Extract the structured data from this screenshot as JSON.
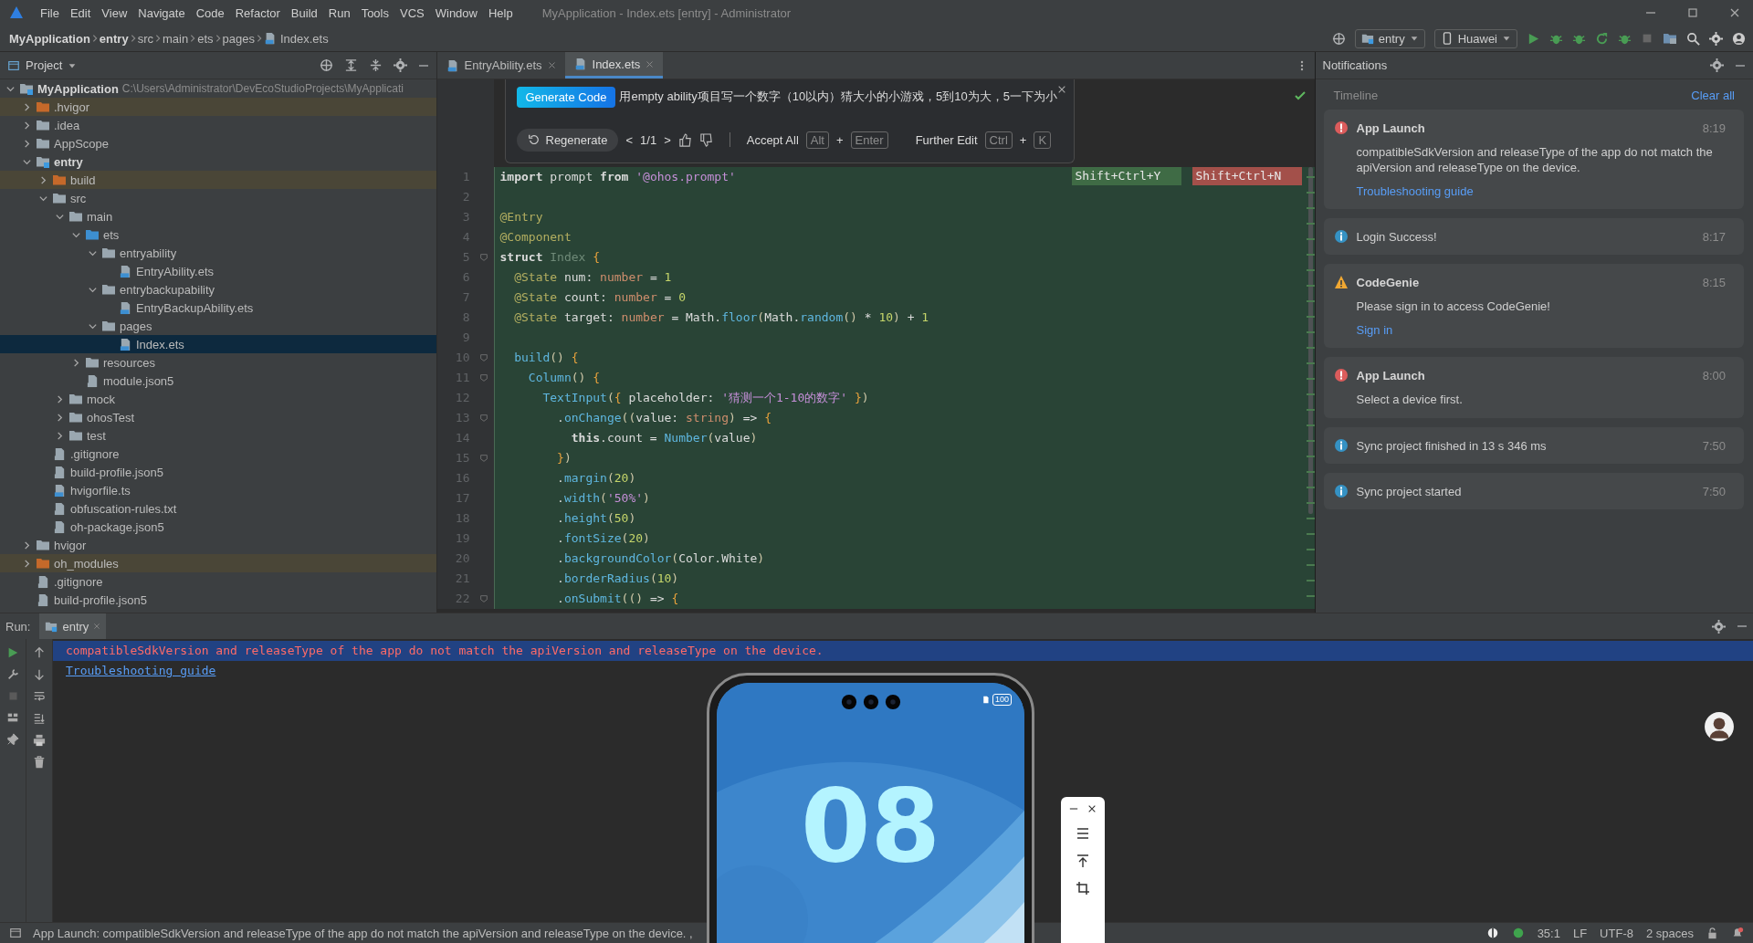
{
  "menu_bar": {
    "items": [
      "File",
      "Edit",
      "View",
      "Navigate",
      "Code",
      "Refactor",
      "Build",
      "Run",
      "Tools",
      "VCS",
      "Window",
      "Help"
    ],
    "window_title": "MyApplication - Index.ets [entry] - Administrator"
  },
  "breadcrumb": [
    {
      "label": "MyApplication",
      "kind": "module"
    },
    {
      "label": "entry",
      "kind": "module"
    },
    {
      "label": "src",
      "kind": "folder"
    },
    {
      "label": "main",
      "kind": "folder"
    },
    {
      "label": "ets",
      "kind": "folder"
    },
    {
      "label": "pages",
      "kind": "folder"
    },
    {
      "label": "Index.ets",
      "kind": "file"
    }
  ],
  "toolbar": {
    "run_config": "entry",
    "device": "Huawei"
  },
  "project": {
    "title": "Project",
    "tree": [
      {
        "label": "MyApplication",
        "kind": "module",
        "path": "C:\\Users\\Administrator\\DevEcoStudioProjects\\MyApplicati",
        "expanded": true,
        "selected": false,
        "children": [
          {
            "label": ".hvigor",
            "kind": "excluded",
            "expanded": false,
            "selected": false
          },
          {
            "label": ".idea",
            "kind": "folder",
            "expanded": false,
            "selected": false
          },
          {
            "label": "AppScope",
            "kind": "folder",
            "expanded": false,
            "selected": false
          },
          {
            "label": "entry",
            "kind": "module",
            "expanded": true,
            "selected": false,
            "children": [
              {
                "label": "build",
                "kind": "excluded",
                "expanded": false,
                "selected": false
              },
              {
                "label": "src",
                "kind": "folder",
                "expanded": true,
                "selected": false,
                "children": [
                  {
                    "label": "main",
                    "kind": "folder",
                    "expanded": true,
                    "selected": false,
                    "children": [
                      {
                        "label": "ets",
                        "kind": "source",
                        "expanded": true,
                        "selected": false,
                        "children": [
                          {
                            "label": "entryability",
                            "kind": "folder",
                            "expanded": true,
                            "selected": false,
                            "children": [
                              {
                                "label": "EntryAbility.ets",
                                "kind": "ets",
                                "selected": false
                              }
                            ]
                          },
                          {
                            "label": "entrybackupability",
                            "kind": "folder",
                            "expanded": true,
                            "selected": false,
                            "children": [
                              {
                                "label": "EntryBackupAbility.ets",
                                "kind": "ets",
                                "selected": false
                              }
                            ]
                          },
                          {
                            "label": "pages",
                            "kind": "folder",
                            "expanded": true,
                            "selected": false,
                            "children": [
                              {
                                "label": "Index.ets",
                                "kind": "ets",
                                "selected": true
                              }
                            ]
                          }
                        ]
                      },
                      {
                        "label": "resources",
                        "kind": "folder",
                        "expanded": false,
                        "selected": false
                      },
                      {
                        "label": "module.json5",
                        "kind": "json",
                        "selected": false
                      }
                    ]
                  },
                  {
                    "label": "mock",
                    "kind": "folder",
                    "expanded": false,
                    "selected": false
                  },
                  {
                    "label": "ohosTest",
                    "kind": "folder",
                    "expanded": false,
                    "selected": false
                  },
                  {
                    "label": "test",
                    "kind": "folder",
                    "expanded": false,
                    "selected": false
                  }
                ]
              },
              {
                "label": ".gitignore",
                "kind": "ignore",
                "selected": false
              },
              {
                "label": "build-profile.json5",
                "kind": "json",
                "selected": false
              },
              {
                "label": "hvigorfile.ts",
                "kind": "ts",
                "selected": false
              },
              {
                "label": "obfuscation-rules.txt",
                "kind": "txt",
                "selected": false
              },
              {
                "label": "oh-package.json5",
                "kind": "json",
                "selected": false
              }
            ]
          },
          {
            "label": "hvigor",
            "kind": "folder",
            "expanded": false,
            "selected": false
          },
          {
            "label": "oh_modules",
            "kind": "excluded",
            "expanded": false,
            "selected": false
          },
          {
            "label": ".gitignore",
            "kind": "ignore",
            "selected": false
          },
          {
            "label": "build-profile.json5",
            "kind": "json",
            "selected": false
          }
        ]
      }
    ]
  },
  "editor": {
    "tabs": [
      {
        "label": "EntryAbility.ets",
        "selected": false
      },
      {
        "label": "Index.ets",
        "selected": true
      }
    ],
    "assistant": {
      "button": "Generate Code",
      "prompt": "用empty ability项目写一个数字（10以内）猜大小的小游戏，5到10为大，5一下为小",
      "regenerate": "Regenerate",
      "prev": "<",
      "page": "1/1",
      "next": ">",
      "accept": "Accept All",
      "accept_keys": [
        {
          "kind": "key",
          "text": "Alt"
        },
        {
          "kind": "plus",
          "text": "+"
        },
        {
          "kind": "key",
          "text": "Enter"
        }
      ],
      "edit": "Further Edit",
      "edit_keys": [
        {
          "kind": "key",
          "text": "Ctrl"
        },
        {
          "kind": "plus",
          "text": "+"
        },
        {
          "kind": "key",
          "text": "K"
        }
      ]
    },
    "diff_shortcuts": [
      {
        "label": "Shift+Ctrl+Y",
        "kind": "accept"
      },
      {
        "label": "Shift+Ctrl+N",
        "kind": "reject"
      }
    ],
    "lines": [
      {
        "n": "1",
        "fold": false,
        "tokens": [
          {
            "kind": "kw",
            "text": "import "
          },
          {
            "kind": "plain",
            "text": "prompt "
          },
          {
            "kind": "kw",
            "text": "from "
          },
          {
            "kind": "str",
            "text": "'@ohos.prompt'"
          }
        ]
      },
      {
        "n": "2",
        "fold": false
      },
      {
        "n": "3",
        "fold": false,
        "tokens": [
          {
            "kind": "dec",
            "text": "@Entry"
          }
        ]
      },
      {
        "n": "4",
        "fold": false,
        "tokens": [
          {
            "kind": "dec",
            "text": "@Component"
          }
        ]
      },
      {
        "n": "5",
        "fold": true,
        "tokens": [
          {
            "kind": "kw",
            "text": "struct "
          },
          {
            "kind": "cls",
            "text": "Index "
          },
          {
            "kind": "brace",
            "text": "{"
          }
        ]
      },
      {
        "n": "6",
        "fold": false,
        "tokens": [
          {
            "kind": "dec",
            "text": "  @State "
          },
          {
            "kind": "plain",
            "text": "num: "
          },
          {
            "kind": "type",
            "text": "number "
          },
          {
            "kind": "plain",
            "text": "= "
          },
          {
            "kind": "num",
            "text": "1"
          }
        ]
      },
      {
        "n": "7",
        "fold": false,
        "tokens": [
          {
            "kind": "dec",
            "text": "  @State "
          },
          {
            "kind": "plain",
            "text": "count: "
          },
          {
            "kind": "type",
            "text": "number "
          },
          {
            "kind": "plain",
            "text": "= "
          },
          {
            "kind": "num",
            "text": "0"
          }
        ]
      },
      {
        "n": "8",
        "fold": false,
        "tokens": [
          {
            "kind": "dec",
            "text": "  @State "
          },
          {
            "kind": "plain",
            "text": "target: "
          },
          {
            "kind": "type",
            "text": "number "
          },
          {
            "kind": "plain",
            "text": "= Math."
          },
          {
            "kind": "fn",
            "text": "floor"
          },
          {
            "kind": "paren",
            "text": "("
          },
          {
            "kind": "plain",
            "text": "Math."
          },
          {
            "kind": "fn",
            "text": "random"
          },
          {
            "kind": "paren",
            "text": "() "
          },
          {
            "kind": "plain",
            "text": "* "
          },
          {
            "kind": "num",
            "text": "10"
          },
          {
            "kind": "paren",
            "text": ") "
          },
          {
            "kind": "plain",
            "text": "+ "
          },
          {
            "kind": "num",
            "text": "1"
          }
        ]
      },
      {
        "n": "9",
        "fold": false
      },
      {
        "n": "10",
        "fold": true,
        "tokens": [
          {
            "kind": "fn",
            "text": "  build"
          },
          {
            "kind": "paren",
            "text": "() "
          },
          {
            "kind": "brace",
            "text": "{"
          }
        ]
      },
      {
        "n": "11",
        "fold": true,
        "tokens": [
          {
            "kind": "fn",
            "text": "    Column"
          },
          {
            "kind": "paren",
            "text": "() "
          },
          {
            "kind": "brace",
            "text": "{"
          }
        ]
      },
      {
        "n": "12",
        "fold": false,
        "tokens": [
          {
            "kind": "fn",
            "text": "      TextInput"
          },
          {
            "kind": "paren",
            "text": "("
          },
          {
            "kind": "brace",
            "text": "{ "
          },
          {
            "kind": "plain",
            "text": "placeholder: "
          },
          {
            "kind": "str",
            "text": "'猜测一个1-10的数字'"
          },
          {
            "kind": "brace",
            "text": " }"
          },
          {
            "kind": "paren",
            "text": ")"
          }
        ]
      },
      {
        "n": "13",
        "fold": true,
        "tokens": [
          {
            "kind": "plain",
            "text": "        ."
          },
          {
            "kind": "fn",
            "text": "onChange"
          },
          {
            "kind": "paren",
            "text": "(("
          },
          {
            "kind": "plain",
            "text": "value: "
          },
          {
            "kind": "type",
            "text": "string"
          },
          {
            "kind": "paren",
            "text": ") "
          },
          {
            "kind": "plain",
            "text": "=> "
          },
          {
            "kind": "brace",
            "text": "{"
          }
        ]
      },
      {
        "n": "14",
        "fold": false,
        "tokens": [
          {
            "kind": "kw",
            "text": "          this"
          },
          {
            "kind": "plain",
            "text": ".count = "
          },
          {
            "kind": "fn",
            "text": "Number"
          },
          {
            "kind": "paren",
            "text": "("
          },
          {
            "kind": "plain",
            "text": "value"
          },
          {
            "kind": "paren",
            "text": ")"
          }
        ]
      },
      {
        "n": "15",
        "fold": true,
        "tokens": [
          {
            "kind": "brace",
            "text": "        }"
          },
          {
            "kind": "paren",
            "text": ")"
          }
        ]
      },
      {
        "n": "16",
        "fold": false,
        "tokens": [
          {
            "kind": "plain",
            "text": "        ."
          },
          {
            "kind": "fn",
            "text": "margin"
          },
          {
            "kind": "paren",
            "text": "("
          },
          {
            "kind": "num",
            "text": "20"
          },
          {
            "kind": "paren",
            "text": ")"
          }
        ]
      },
      {
        "n": "17",
        "fold": false,
        "tokens": [
          {
            "kind": "plain",
            "text": "        ."
          },
          {
            "kind": "fn",
            "text": "width"
          },
          {
            "kind": "paren",
            "text": "("
          },
          {
            "kind": "str",
            "text": "'50%'"
          },
          {
            "kind": "paren",
            "text": ")"
          }
        ]
      },
      {
        "n": "18",
        "fold": false,
        "tokens": [
          {
            "kind": "plain",
            "text": "        ."
          },
          {
            "kind": "fn",
            "text": "height"
          },
          {
            "kind": "paren",
            "text": "("
          },
          {
            "kind": "num",
            "text": "50"
          },
          {
            "kind": "paren",
            "text": ")"
          }
        ]
      },
      {
        "n": "19",
        "fold": false,
        "tokens": [
          {
            "kind": "plain",
            "text": "        ."
          },
          {
            "kind": "fn",
            "text": "fontSize"
          },
          {
            "kind": "paren",
            "text": "("
          },
          {
            "kind": "num",
            "text": "20"
          },
          {
            "kind": "paren",
            "text": ")"
          }
        ]
      },
      {
        "n": "20",
        "fold": false,
        "tokens": [
          {
            "kind": "plain",
            "text": "        ."
          },
          {
            "kind": "fn",
            "text": "backgroundColor"
          },
          {
            "kind": "paren",
            "text": "("
          },
          {
            "kind": "plain",
            "text": "Color.White"
          },
          {
            "kind": "paren",
            "text": ")"
          }
        ]
      },
      {
        "n": "21",
        "fold": false,
        "tokens": [
          {
            "kind": "plain",
            "text": "        ."
          },
          {
            "kind": "fn",
            "text": "borderRadius"
          },
          {
            "kind": "paren",
            "text": "("
          },
          {
            "kind": "num",
            "text": "10"
          },
          {
            "kind": "paren",
            "text": ")"
          }
        ]
      },
      {
        "n": "22",
        "fold": true,
        "tokens": [
          {
            "kind": "plain",
            "text": "        ."
          },
          {
            "kind": "fn",
            "text": "onSubmit"
          },
          {
            "kind": "paren",
            "text": "(() "
          },
          {
            "kind": "plain",
            "text": "=> "
          },
          {
            "kind": "brace",
            "text": "{"
          }
        ]
      }
    ]
  },
  "notifications": {
    "title": "Notifications",
    "section": "Timeline",
    "clear": "Clear all",
    "items": [
      {
        "kind": "error",
        "title": "App Launch",
        "time": "8:19",
        "body": "compatibleSdkVersion and releaseType of the app do not match the apiVersion and releaseType on the device.",
        "link": "Troubleshooting guide"
      },
      {
        "kind": "info",
        "text": "Login Success!",
        "time": "8:17"
      },
      {
        "kind": "warning",
        "title": "CodeGenie",
        "time": "8:15",
        "body": "Please sign in to access CodeGenie!",
        "link": "Sign in"
      },
      {
        "kind": "error",
        "title": "App Launch",
        "time": "8:00",
        "body": "Select a device first."
      },
      {
        "kind": "info",
        "text": "Sync project finished in 13 s 346 ms",
        "time": "7:50"
      },
      {
        "kind": "info",
        "text": "Sync project started",
        "time": "7:50"
      }
    ]
  },
  "run": {
    "label": "Run:",
    "tabs": [
      {
        "label": "entry",
        "selected": true
      }
    ],
    "console": [
      {
        "kind": "error",
        "text": "compatibleSdkVersion and releaseType of the app do not match the apiVersion and releaseType on the device."
      },
      {
        "kind": "link",
        "text": "Troubleshooting guide"
      }
    ]
  },
  "emulator": {
    "battery": "100",
    "clock": [
      "08"
    ]
  },
  "status_bar": {
    "message": "App Launch: compatibleSdkVersion and releaseType of the app do not match the apiVersion and releaseType on the device. ,",
    "position": "35:1",
    "line_separator": "LF",
    "encoding": "UTF-8",
    "indent": "2 spaces"
  }
}
